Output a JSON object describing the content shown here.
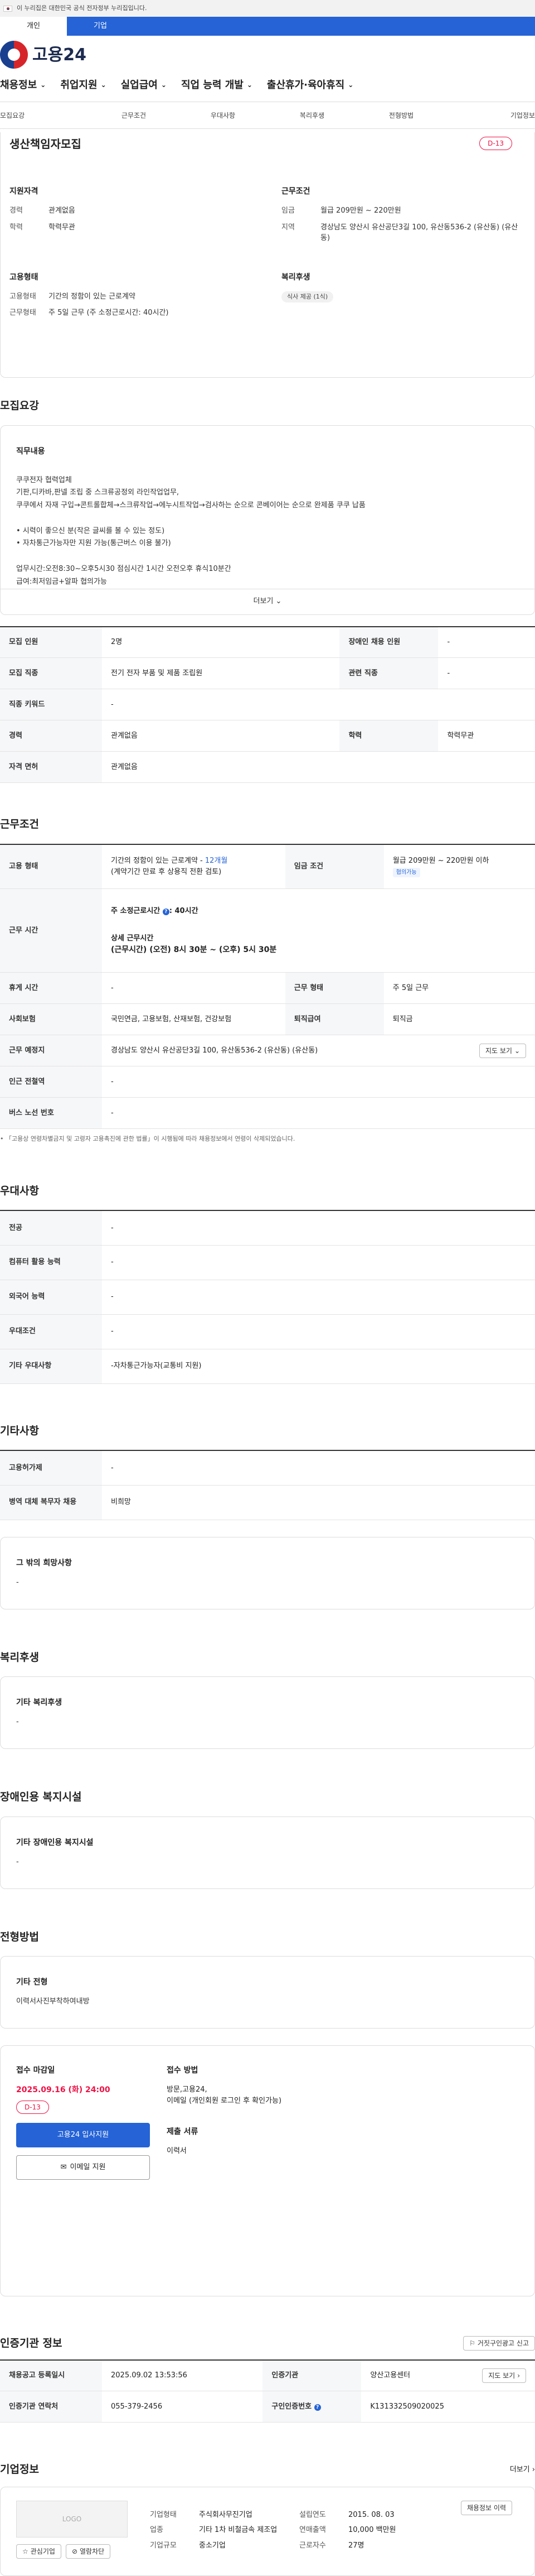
{
  "gov_banner": {
    "text": "이 누리집은 대한민국 공식 전자정부 누리집입니다."
  },
  "user_tabs": [
    "개인",
    "기업"
  ],
  "brand": {
    "name": "고용24"
  },
  "gnb": [
    "채용정보",
    "취업지원",
    "실업급여",
    "직업 능력 개발",
    "출산휴가·육아휴직"
  ],
  "anchor_nav": [
    "모집요강",
    "근무조건",
    "우대사항",
    "복리후생",
    "전형방법",
    "기업정보"
  ],
  "summary": {
    "title": "생산책임자모집",
    "dday": "D-13",
    "qual_title": "지원자격",
    "qual": [
      {
        "k": "경력",
        "v": "관계없음"
      },
      {
        "k": "학력",
        "v": "학력무관"
      }
    ],
    "cond_title": "근무조건",
    "cond": [
      {
        "k": "임금",
        "v": "월급 209만원 ~ 220만원"
      },
      {
        "k": "지역",
        "v": "경상남도 양산시 유산공단3길 100, 유산동536-2 (유산동) (유산동)"
      }
    ],
    "emp_title": "고용형태",
    "emp": [
      {
        "k": "고용형태",
        "v": "기간의 정함이 있는 근로계약"
      },
      {
        "k": "근무형태",
        "v": "주 5일 근무 (주 소정근로시간: 40시간)"
      }
    ],
    "benefit_title": "복리후생",
    "benefit_chip": "식사 제공 (1식)"
  },
  "recruit": {
    "section": "모집요강",
    "card_title": "직무내용",
    "body": "쿠쿠전자 협력업체\n기판,디카바,판넬 조립 중 스크류공정외 라인작업업무,\n쿠쿠에서 자재 구입→콘트롤합체→스크류작업→에누시트작업→검사하는 순으로 콘베이어는 순으로 완제품 쿠쿠 납품\n\n• 시력이 좋으신 분(작은 글씨를 볼 수 있는 정도)\n• 자차통근가능자만 지원 가능(통근버스 이용 불가)\n\n업무시간:오전8:30~오후5시30   점심시간 1시간   오전오후 휴식10분간\n급여:최저임금+알파     협의가능",
    "more": "더보기"
  },
  "recruit_table": [
    {
      "k1": "모집 인원",
      "v1": "2명",
      "k2": "장애인 채용 인원",
      "v2": "-"
    },
    {
      "k1": "모집 직종",
      "v1": "전기 전자 부품 및 제품 조립원",
      "k2": "관련 직종",
      "v2": "-"
    },
    {
      "k1": "직종 키워드",
      "v1": "-"
    },
    {
      "k1": "경력",
      "v1": "관계없음",
      "k2": "학력",
      "v2": "학력무관"
    },
    {
      "k1": "자격 면허",
      "v1": "관계없음"
    }
  ],
  "work": {
    "section": "근무조건",
    "emp_type_k": "고용 형태",
    "emp_type_v": "기간의 정함이 있는 근로계약 - ",
    "emp_type_period": "12개월",
    "emp_type_note": "(계약기간 만료 후 상용직 전환 검토)",
    "wage_k": "임금 조건",
    "wage_v": "월급 209만원 ~ 220만원 이하",
    "wage_tag": "협의가능",
    "hours_k": "근무 시간",
    "hours_weekly": "주 소정근로시간",
    "hours_weekly_v": "40시간",
    "hours_detail_title": "상세 근무시간",
    "hours_detail": "(근무시간) (오전) 8시 30분 ~ (오후) 5시 30분",
    "rest_k": "휴게 시간",
    "rest_v": "-",
    "worktype_k": "근무 형태",
    "worktype_v": "주 5일 근무",
    "insurance_k": "사회보험",
    "insurance_v": "국민연금, 고용보험, 산재보험, 건강보험",
    "severance_k": "퇴직급여",
    "severance_v": "퇴직금",
    "place_k": "근무 예정지",
    "place_v": "경상남도 양산시 유산공단3길 100, 유산동536-2 (유산동) (유산동)",
    "map_btn": "지도 보기",
    "subway_k": "인근 전철역",
    "subway_v": "-",
    "bus_k": "버스 노선 번호",
    "bus_v": "-",
    "footnote": "「고용상 연령차별금지 및 고령자 고용촉진에 관한 법률」이 시행됨에 따라 채용정보에서 연령이 삭제되었습니다."
  },
  "pref": {
    "section": "우대사항",
    "rows": [
      {
        "k": "전공",
        "v": "-"
      },
      {
        "k": "컴퓨터 활용 능력",
        "v": "-"
      },
      {
        "k": "외국어 능력",
        "v": "-"
      },
      {
        "k": "우대조건",
        "v": "-"
      },
      {
        "k": "기타 우대사항",
        "v": "-자차통근가능자(교통비 지원)"
      }
    ]
  },
  "etc": {
    "section": "기타사항",
    "rows": [
      {
        "k": "고용허가제",
        "v": "-"
      },
      {
        "k": "병역 대체 복무자 채용",
        "v": "비희망"
      }
    ],
    "card_title": "그 밖의 희망사항",
    "card_val": "-"
  },
  "welfare": {
    "section": "복리후생",
    "card_title": "기타 복리후생",
    "card_val": "-"
  },
  "disabled": {
    "section": "장애인용 복지시설",
    "card_title": "기타 장애인용 복지시설",
    "card_val": "-"
  },
  "screening": {
    "section": "전형방법",
    "card_title": "기타 전형",
    "card_val": "이력서사진부착하여내방",
    "deadline_title": "접수 마감일",
    "deadline": "2025.09.16 (화) 24:00",
    "dday": "D-13",
    "apply_btn": "고용24 입사지원",
    "email_btn": "이메일 지원",
    "method_title": "접수 방법",
    "method": "방문,고용24,\n이메일 (개인회원 로그인 후 확인가능)",
    "docs_title": "제출 서류",
    "docs": "이력서"
  },
  "cert": {
    "section": "인증기관 정보",
    "report_btn": "거짓구인광고 신고",
    "reg_k": "채용공고 등록일시",
    "reg_v": "2025.09.02 13:53:56",
    "org_k": "인증기관",
    "org_v": "양산고용센터",
    "map_btn": "지도 보기",
    "tel_k": "인증기관 연락처",
    "tel_v": "055-379-2456",
    "id_k": "구인인증번호",
    "id_v": "K131332509020025"
  },
  "company": {
    "section": "기업정보",
    "more": "더보기",
    "logo_text": "LOGO",
    "fav_btn": "관심기업",
    "block_btn": "열람차단",
    "type_k": "기업형태",
    "type_v": "주식회사무진기업",
    "founded_k": "설립연도",
    "founded_v": "2015. 08. 03",
    "industry_k": "업종",
    "industry_v": "기타 1차 비철금속 제조업",
    "sales_k": "연매출액",
    "sales_v": "10,000 백만원",
    "employees_k": "근로자수",
    "employees_v": "27명",
    "size_k": "기업규모",
    "size_v": "중소기업",
    "jobs_btn": "채용정보 이력"
  }
}
